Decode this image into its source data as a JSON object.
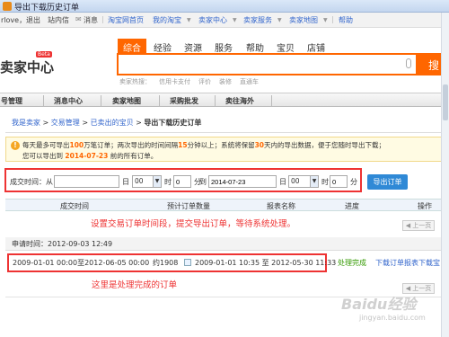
{
  "window": {
    "title": "导出下载历史订单"
  },
  "topnav": {
    "user": "rlove，退出",
    "site_msg": "站内信",
    "messages": "消息",
    "home": "淘宝网首页",
    "my_taobao": "我的淘宝",
    "seller_center": "卖家中心",
    "seller_service": "卖家服务",
    "sitemap": "卖家地图",
    "help": "帮助"
  },
  "header": {
    "logo": "卖家中心",
    "beta": "Beta",
    "search_tabs": [
      "综合",
      "经验",
      "资源",
      "服务",
      "帮助",
      "宝贝",
      "店铺"
    ],
    "search_button": "搜",
    "hot_label": "卖家热搜：",
    "hot_terms": [
      "信用卡支付",
      "评价",
      "装修",
      "直通车"
    ]
  },
  "menu": {
    "items": [
      "号管理",
      "消息中心",
      "卖家地图",
      "采购批发",
      "卖往海外"
    ]
  },
  "breadcrumb": {
    "b1": "我是卖家",
    "b2": "交易管理",
    "b3": "已卖出的宝贝",
    "current": "导出下载历史订单",
    "sep": ">"
  },
  "notice": {
    "l1_a": "每天最多可导出",
    "l1_n1": "100",
    "l1_b": "万笔订单；两次导出的时间间隔",
    "l1_n2": "15",
    "l1_c": "分钟以上；系统将保留",
    "l1_n3": "30",
    "l1_d": "天内的导出数据，便于您随时导出下载；",
    "l2_a": "您可以导出到",
    "l2_date": "2014-07-23",
    "l2_b": "前的所有订单。"
  },
  "form": {
    "label_time": "成交时间：从",
    "label_day": "日",
    "label_hour": "时",
    "label_min": "分",
    "label_to": "到",
    "start_date": "",
    "start_hour": "00",
    "start_min": "0",
    "end_date": "2014-07-23",
    "end_hour": "00",
    "end_min": "0",
    "submit": "导出订单"
  },
  "table": {
    "headers": [
      "成交时间",
      "预计订单数量",
      "报表名称",
      "进度",
      "操作"
    ],
    "prev_page": "◀ 上一页",
    "request_label": "申请时间：",
    "request_time": "2012-09-03 12:49",
    "row": {
      "range": "2009-01-01 00:00至2012-06-05 00:00",
      "count": "约1908",
      "report": "2009-01-01 10:35 至 2012-05-30 11:33",
      "status": "处理完成",
      "action1": "下载订单报表",
      "action2": "下载宝"
    }
  },
  "annotations": {
    "a1": "设置交易订单时间段，提交导出订单，等待系统处理。",
    "a2": "这里是处理完成的订单"
  },
  "watermark": {
    "brand": "Baidu经验",
    "url": "jingyan.baidu.com"
  },
  "colors": {
    "accent": "#ff6600",
    "link": "#3366cc",
    "annotation": "#ee3333",
    "button": "#2f89d6"
  }
}
